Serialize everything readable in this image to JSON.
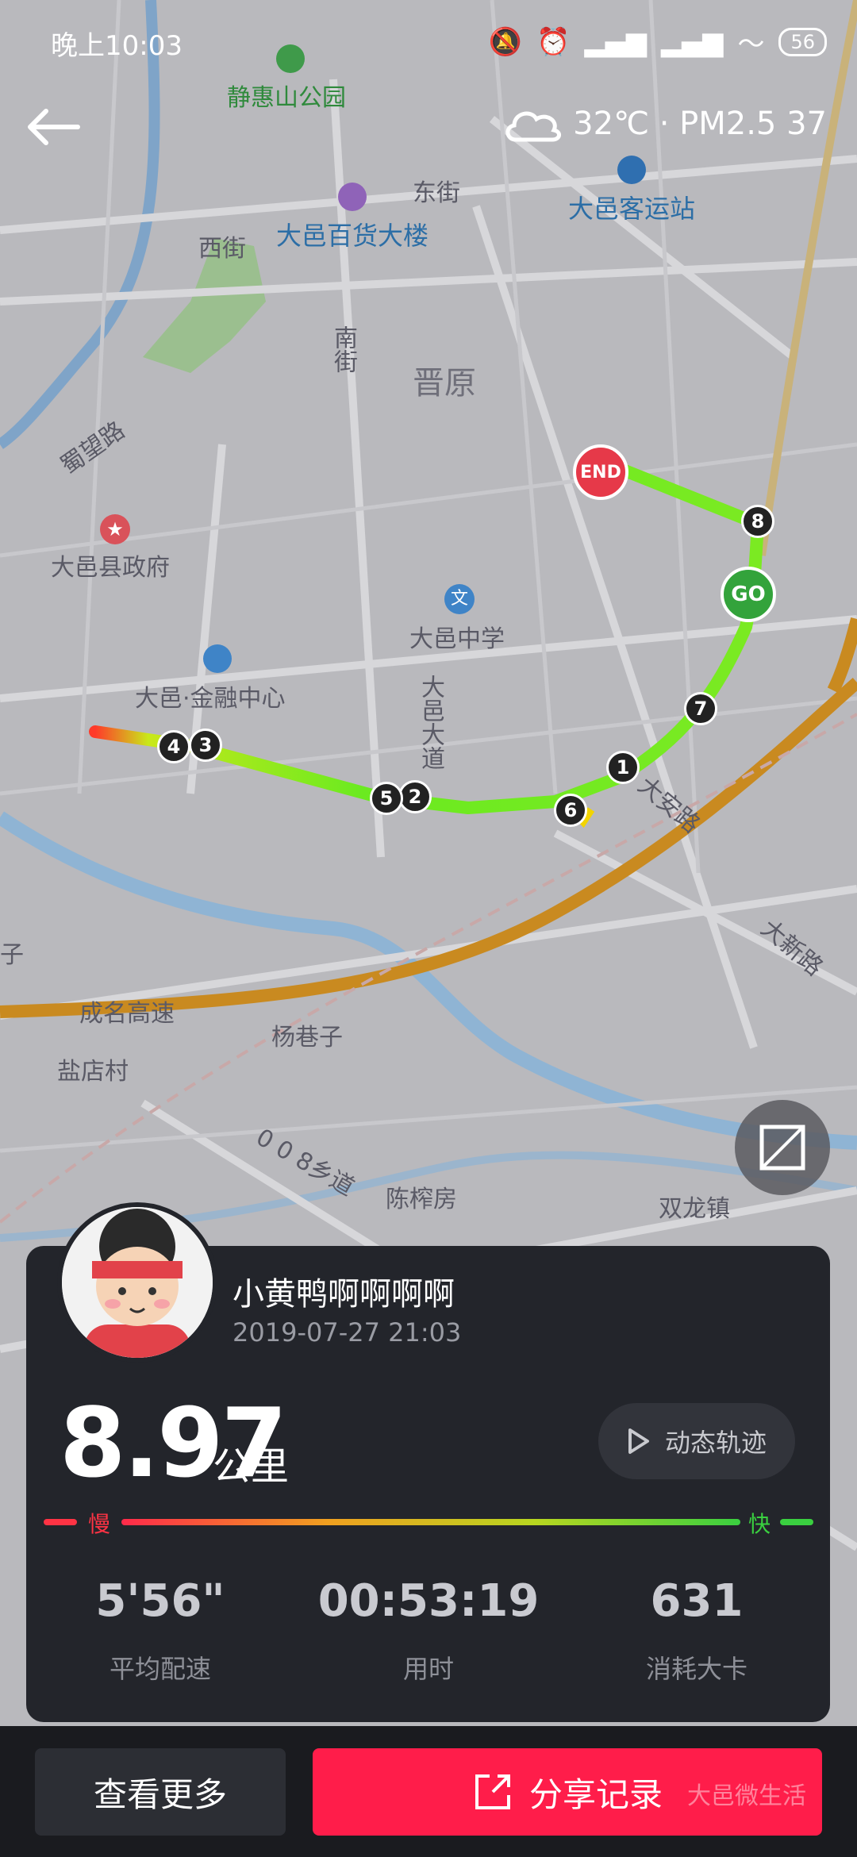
{
  "status_bar": {
    "time": "晚上10:03",
    "battery": "56"
  },
  "weather": {
    "text": "32℃ · PM2.5 37"
  },
  "map_labels": {
    "park": "静惠山公园",
    "store": "大邑百货大楼",
    "bus": "大邑客运站",
    "east_st": "东街",
    "west_st": "西街",
    "south_st": "南街",
    "jinyuan": "晋原",
    "shuwang": "蜀望路",
    "gov": "大邑县政府",
    "school": "大邑中学",
    "finance": "大邑·金融中心",
    "dayi_ave": "大邑大道",
    "daan": "大安路",
    "daxin": "大新路",
    "chengming": "成名高速",
    "yangxiang": "杨巷子",
    "yandian": "盐店村",
    "township": "0 0 8乡道",
    "chenzha": "陈榨房",
    "shuanglong": "双龙镇",
    "zi": "子"
  },
  "route": {
    "start_label": "GO",
    "end_label": "END",
    "markers": [
      "1",
      "2",
      "3",
      "4",
      "5",
      "6",
      "7",
      "8"
    ]
  },
  "user": {
    "name": "小黄鸭啊啊啊啊",
    "datetime": "2019-07-27 21:03"
  },
  "run": {
    "distance": "8.97",
    "distance_unit": "公里",
    "replay_label": "动态轨迹",
    "slow_label": "慢",
    "fast_label": "快"
  },
  "stats": [
    {
      "value": "5'56\"",
      "label": "平均配速"
    },
    {
      "value": "00:53:19",
      "label": "用时"
    },
    {
      "value": "631",
      "label": "消耗大卡"
    }
  ],
  "buttons": {
    "more": "查看更多",
    "share": "分享记录"
  },
  "watermark": "大邑微生活"
}
